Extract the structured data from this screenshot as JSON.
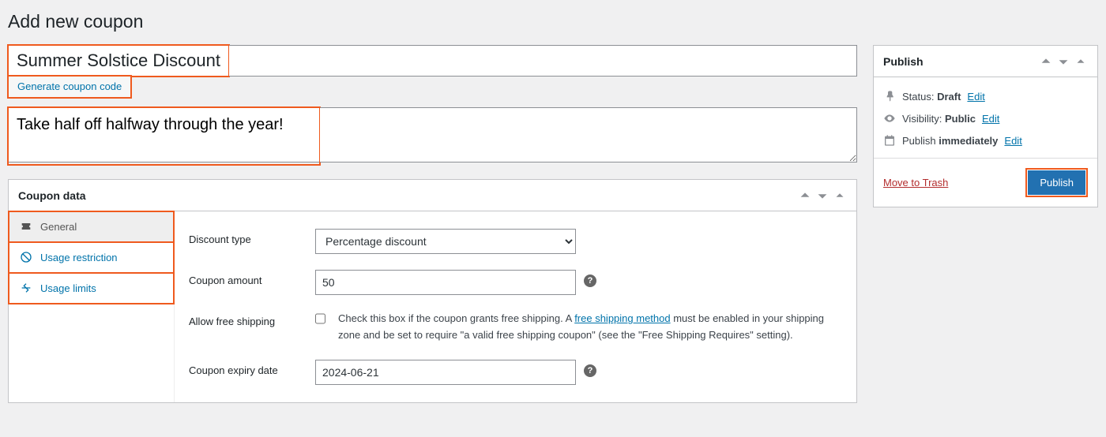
{
  "page_title": "Add new coupon",
  "coupon_title": "Summer Solstice Discount",
  "generate_label": "Generate coupon code",
  "coupon_description": "Take half off halfway through the year!",
  "coupon_data": {
    "panel_title": "Coupon data",
    "tabs": {
      "general": "General",
      "usage_restriction": "Usage restriction",
      "usage_limits": "Usage limits"
    },
    "fields": {
      "discount_type_label": "Discount type",
      "discount_type_value": "Percentage discount",
      "coupon_amount_label": "Coupon amount",
      "coupon_amount_value": "50",
      "allow_free_shipping_label": "Allow free shipping",
      "free_shipping_text_before": "Check this box if the coupon grants free shipping. A ",
      "free_shipping_link": "free shipping method",
      "free_shipping_text_after": " must be enabled in your shipping zone and be set to require \"a valid free shipping coupon\" (see the \"Free Shipping Requires\" setting).",
      "expiry_label": "Coupon expiry date",
      "expiry_value": "2024-06-21"
    }
  },
  "publish": {
    "panel_title": "Publish",
    "status_label": "Status: ",
    "status_value": "Draft",
    "visibility_label": "Visibility: ",
    "visibility_value": "Public",
    "schedule_label": "Publish ",
    "schedule_value": "immediately",
    "edit": "Edit",
    "trash": "Move to Trash",
    "publish_btn": "Publish"
  }
}
